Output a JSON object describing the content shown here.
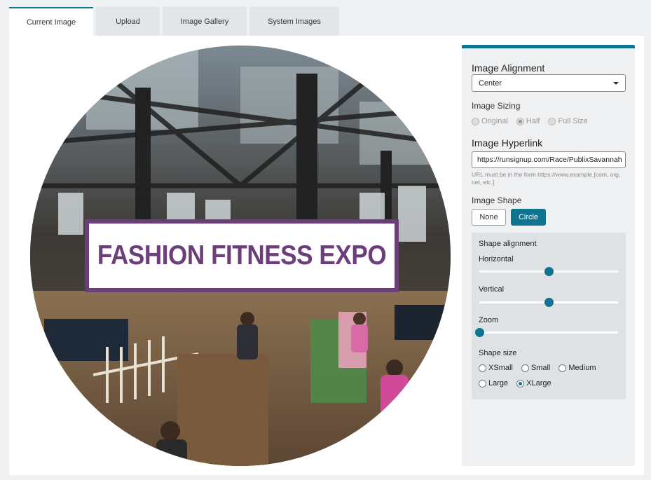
{
  "tabs": [
    {
      "label": "Current Image",
      "active": true
    },
    {
      "label": "Upload"
    },
    {
      "label": "Image Gallery"
    },
    {
      "label": "System Images"
    }
  ],
  "image": {
    "banner_text": "FASHION FITNESS EXPO"
  },
  "settings": {
    "alignment_title": "Image Alignment",
    "alignment_value": "Center",
    "sizing_title": "Image Sizing",
    "sizing_options": [
      "Original",
      "Half",
      "Full Size"
    ],
    "sizing_selected": "Half",
    "hyperlink_title": "Image Hyperlink",
    "hyperlink_value": "https://runsignup.com/Race/PublixSavannah",
    "hyperlink_hint": "URL must be in the form https://www.example.[com, org, net, etc.]",
    "shape_title": "Image Shape",
    "shape_none": "None",
    "shape_circle": "Circle",
    "shape_alignment_title": "Shape alignment",
    "horizontal_label": "Horizontal",
    "horizontal_value": 0.5,
    "vertical_label": "Vertical",
    "vertical_value": 0.5,
    "zoom_label": "Zoom",
    "zoom_value": 0,
    "shape_size_title": "Shape size",
    "size_options": [
      "XSmall",
      "Small",
      "Medium",
      "Large",
      "XLarge"
    ],
    "size_selected": "XLarge"
  },
  "colors": {
    "accent": "#0e7490",
    "banner_purple": "#6c3e7a"
  }
}
